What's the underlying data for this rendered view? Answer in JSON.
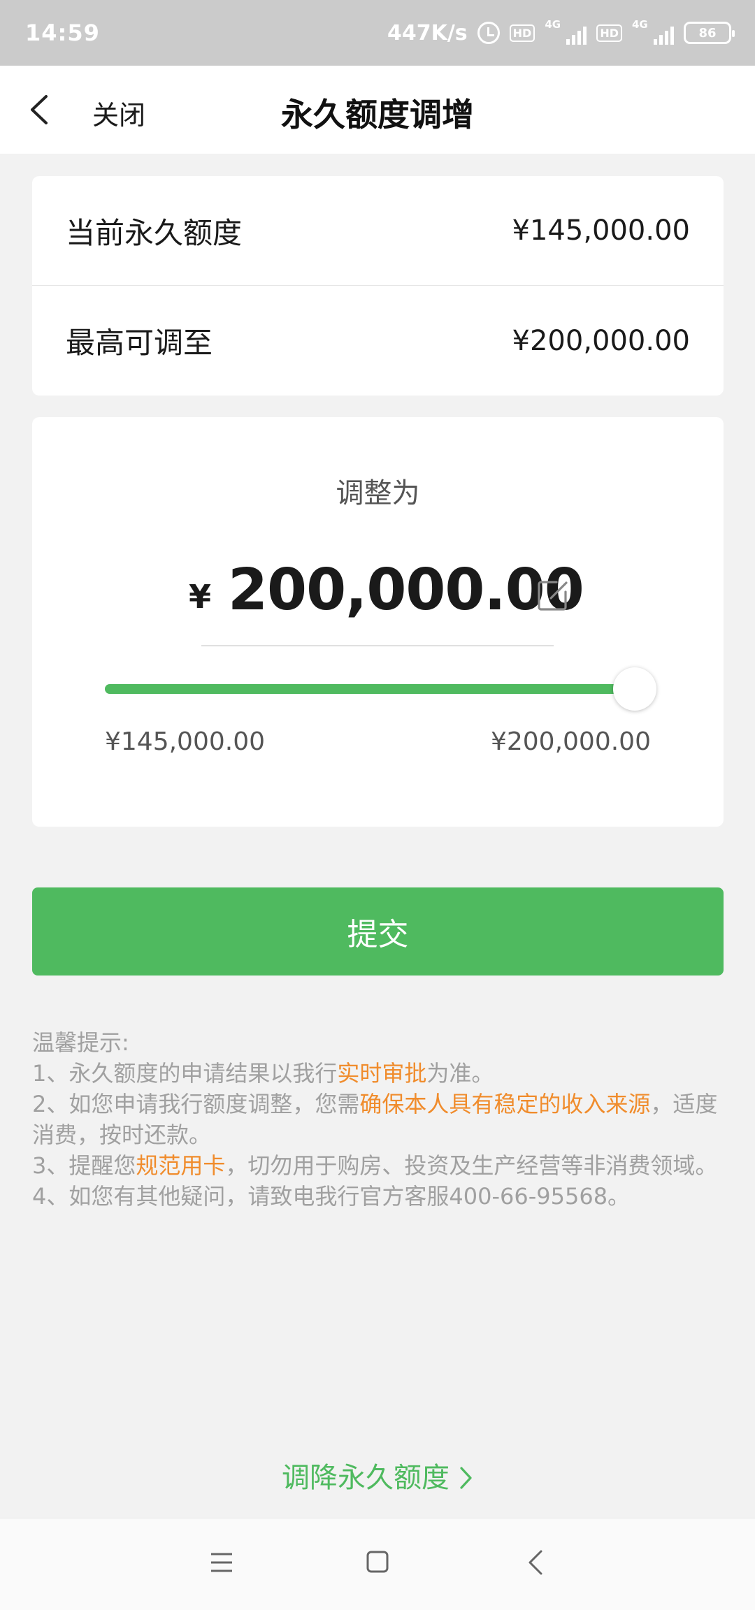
{
  "status_bar": {
    "time": "14:59",
    "speed": "447K/s",
    "hd1": "HD",
    "net1": "4G",
    "hd2": "HD",
    "net2": "4G",
    "battery": "86"
  },
  "header": {
    "close_label": "关闭",
    "title": "永久额度调增"
  },
  "info": {
    "current_label": "当前永久额度",
    "current_value": "¥145,000.00",
    "max_label": "最高可调至",
    "max_value": "¥200,000.00"
  },
  "adjust": {
    "label": "调整为",
    "currency": "¥",
    "amount": "200,000.00",
    "slider_level": 1.0,
    "min_label": "¥145,000.00",
    "max_label": "¥200,000.00"
  },
  "submit_label": "提交",
  "tips": {
    "title": "温馨提示:",
    "item1_pre": "1、永久额度的申请结果以我行",
    "item1_hl": "实时审批",
    "item1_post": "为准。",
    "item2_pre": "2、如您申请我行额度调整，您需",
    "item2_hl": "确保本人具有稳定的收入来源",
    "item2_post": "，适度消费，按时还款。",
    "item3_pre": "3、提醒您",
    "item3_hl": "规范用卡",
    "item3_post": "，切勿用于购房、投资及生产经营等非消费领域。",
    "item4": "4、如您有其他疑问，请致电我行官方客服400-66-95568。"
  },
  "downgrade_label": "调降永久额度",
  "colors": {
    "accent_green": "#4fba5f",
    "highlight_orange": "#f08c2c"
  }
}
